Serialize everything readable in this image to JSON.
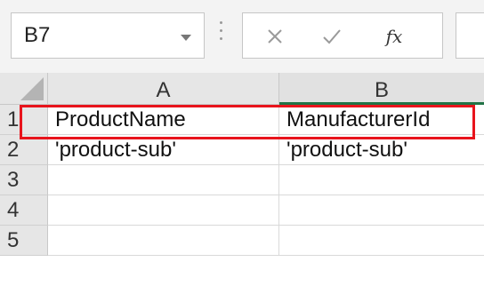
{
  "formula_bar": {
    "name_box": "B7",
    "fx_label": "fx",
    "formula_value": ""
  },
  "grid": {
    "columns": [
      "A",
      "B"
    ],
    "rows": [
      {
        "num": "1",
        "a": "ProductName",
        "b": "ManufacturerId"
      },
      {
        "num": "2",
        "a": "'product-sub'",
        "b": "'product-sub'"
      },
      {
        "num": "3",
        "a": "",
        "b": ""
      },
      {
        "num": "4",
        "a": "",
        "b": ""
      },
      {
        "num": "5",
        "a": "",
        "b": ""
      }
    ]
  },
  "icons": {
    "cancel": "close-icon",
    "enter": "checkmark-icon",
    "insert_function": "fx-icon",
    "name_box_dropdown": "chevron-down-icon",
    "select_all": "select-all-icon"
  },
  "colors": {
    "highlight_box": "#e8141c",
    "selected_column_accent": "#217346"
  }
}
